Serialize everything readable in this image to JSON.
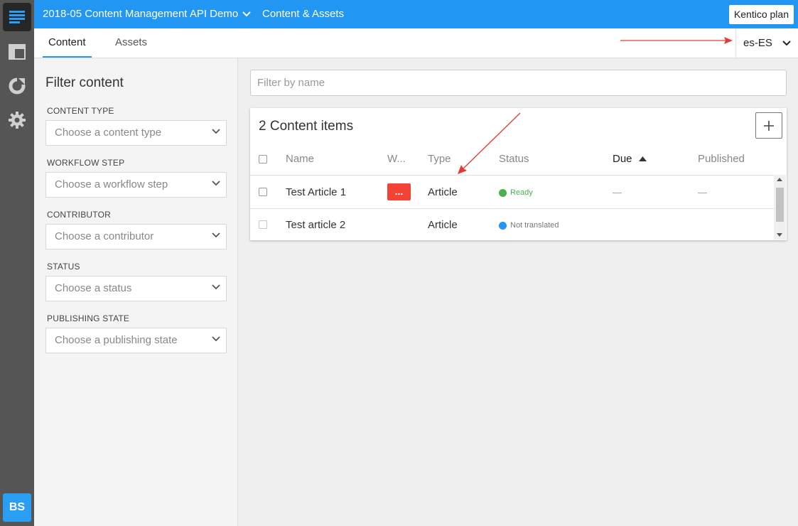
{
  "header": {
    "project_name": "2018-05 Content Management API Demo",
    "section_title": "Content & Assets",
    "plan_button": "Kentico plan"
  },
  "tabs": [
    {
      "label": "Content",
      "active": true
    },
    {
      "label": "Assets",
      "active": false
    }
  ],
  "language": {
    "selected": "es-ES"
  },
  "sidebar": {
    "avatar_initials": "BS",
    "icons": [
      "content-icon",
      "layout-icon",
      "analytics-icon",
      "settings-icon"
    ]
  },
  "filter": {
    "title": "Filter content",
    "groups": [
      {
        "label": "CONTENT TYPE",
        "placeholder": "Choose a content type"
      },
      {
        "label": "WORKFLOW STEP",
        "placeholder": "Choose a workflow step"
      },
      {
        "label": "CONTRIBUTOR",
        "placeholder": "Choose a contributor"
      },
      {
        "label": "STATUS",
        "placeholder": "Choose a status"
      },
      {
        "label": "PUBLISHING STATE",
        "placeholder": "Choose a publishing state"
      }
    ]
  },
  "search": {
    "placeholder": "Filter by name"
  },
  "content_list": {
    "title": "2 Content items",
    "columns": [
      "Name",
      "W...",
      "Type",
      "Status",
      "Due",
      "Published"
    ],
    "rows": [
      {
        "name": "Test Article 1",
        "workflow": "...",
        "type": "Article",
        "status": "Ready",
        "due": "—",
        "published": "—"
      },
      {
        "name": "Test article 2",
        "workflow": "",
        "type": "Article",
        "status": "Not translated",
        "due": "",
        "published": ""
      }
    ]
  },
  "colors": {
    "topbar": "#2196f3",
    "rail": "#555555",
    "workflow_badge": "#f44336",
    "status_ready": "#4caf50",
    "status_not_translated": "#2196f3",
    "annotation_arrow": "#e53935"
  }
}
